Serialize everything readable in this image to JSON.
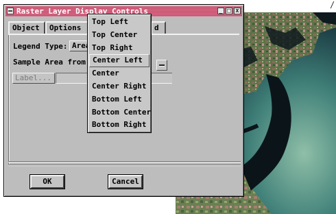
{
  "window": {
    "title": "Raster Layer Display Controls",
    "title_buttons": [
      "_",
      "□",
      "x"
    ]
  },
  "tabs": [
    "Object",
    "Options",
    "",
    "d"
  ],
  "legend_type": {
    "label": "Legend Type:",
    "value": "Area"
  },
  "sample_area": {
    "label": "Sample Area from:"
  },
  "label_button": "Label...",
  "buttons": {
    "ok": "OK",
    "cancel": "Cancel"
  },
  "menu": {
    "items": [
      "Top Left",
      "Top Center",
      "Top Right",
      "Center Left",
      "Center",
      "Center Right",
      "Bottom Left",
      "Bottom Center",
      "Bottom Right"
    ],
    "selected": "Center Left"
  },
  "corner_mark": "/",
  "colors": {
    "title_bar": "#c94a6a",
    "dialog_bg": "#bdbdbd",
    "water": "#0e1a1e"
  },
  "image": {
    "content": "satellite-coastal-image"
  }
}
